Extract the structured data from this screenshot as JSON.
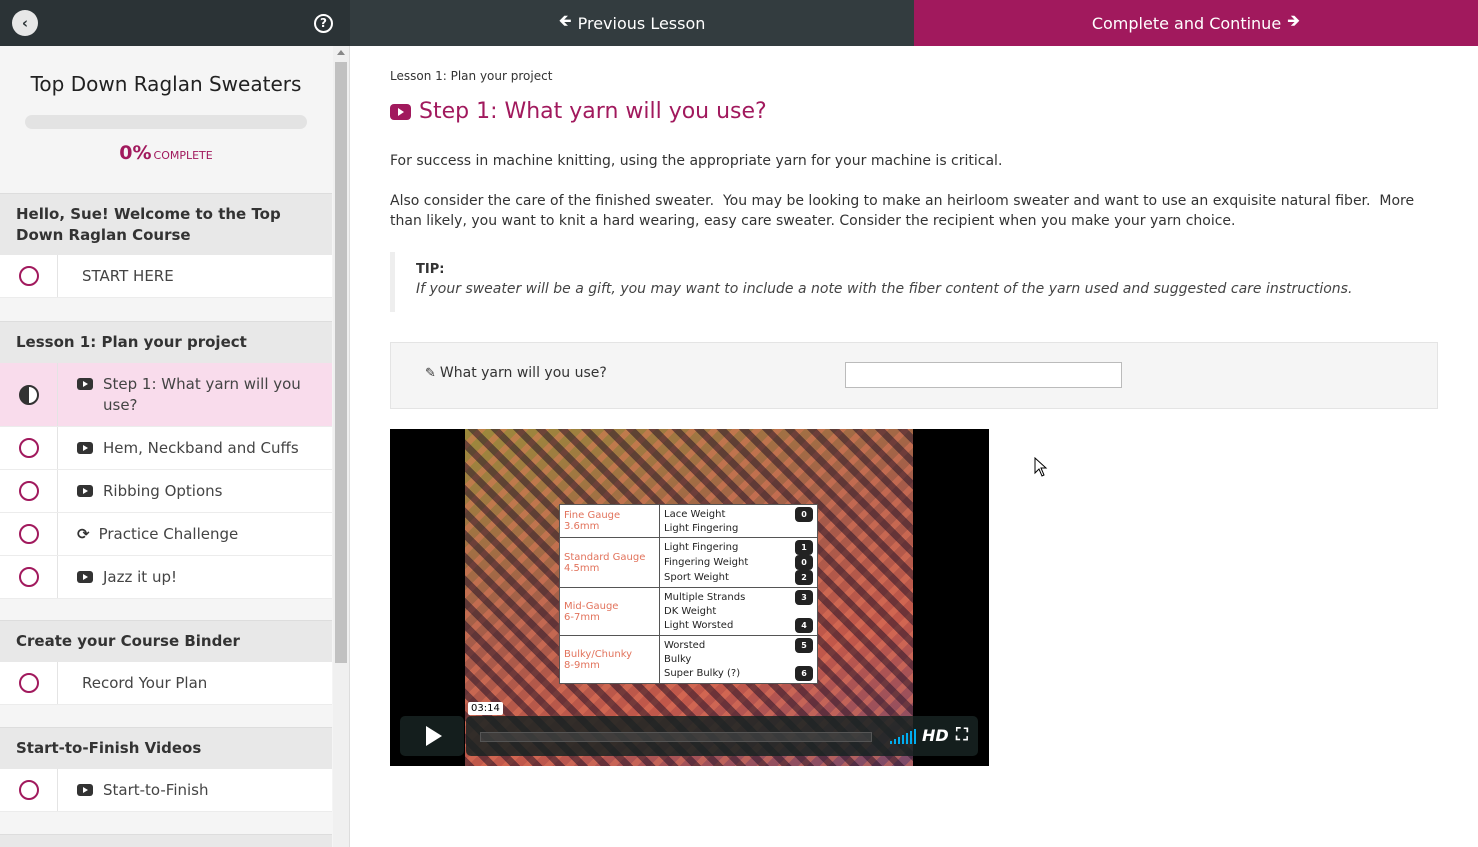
{
  "topbar": {
    "back_icon": "‹",
    "help_icon": "?",
    "previous_label": "Previous Lesson",
    "complete_label": "Complete and Continue",
    "accent": "#a1195d"
  },
  "sidebar": {
    "course_title": "Top Down Raglan Sweaters",
    "progress_percent": 0,
    "progress_value": "0%",
    "progress_label": "COMPLETE",
    "sections": [
      {
        "title": "Hello, Sue! Welcome to the Top Down Raglan Course",
        "lessons": [
          {
            "label": "START HERE",
            "icon": "none",
            "status": "incomplete"
          }
        ]
      },
      {
        "title": "Lesson 1: Plan your project",
        "lessons": [
          {
            "label": "Step 1: What yarn will you use?",
            "icon": "youtube-icon",
            "status": "current"
          },
          {
            "label": "Hem, Neckband and Cuffs",
            "icon": "youtube-icon",
            "status": "incomplete"
          },
          {
            "label": "Ribbing Options",
            "icon": "youtube-icon",
            "status": "incomplete"
          },
          {
            "label": "Practice Challenge",
            "icon": "refresh-icon",
            "status": "incomplete"
          },
          {
            "label": "Jazz it up!",
            "icon": "youtube-icon",
            "status": "incomplete"
          }
        ]
      },
      {
        "title": "Create your Course Binder",
        "lessons": [
          {
            "label": "Record Your Plan",
            "icon": "none",
            "status": "incomplete"
          }
        ]
      },
      {
        "title": "Start-to-Finish Videos",
        "lessons": [
          {
            "label": "Start-to-Finish",
            "icon": "youtube-icon",
            "status": "incomplete"
          }
        ]
      }
    ]
  },
  "main": {
    "breadcrumb": "Lesson 1: Plan your project",
    "title": "Step 1: What yarn will you use?",
    "paragraph1": "For success in machine knitting, using the appropriate yarn for your machine is critical.",
    "paragraph2": "Also consider the care of the finished sweater.  You may be looking to make an heirloom sweater and want to use an exquisite natural fiber.  More than likely, you want to knit a hard wearing, easy care sweater. Consider the recipient when you make your yarn choice.",
    "tip_label": "TIP:",
    "tip_text": "If your sweater will be a gift, you may want to include a note with the fiber content of the yarn used and suggested care instructions.",
    "question_label": "What yarn will you use?",
    "answer_value": "",
    "video": {
      "time": "03:14",
      "hd_label": "HD",
      "table": [
        {
          "gauge": [
            "Fine Gauge",
            "3.6mm"
          ],
          "weights": [
            [
              "Lace Weight",
              "0"
            ],
            [
              "Light Fingering",
              ""
            ]
          ]
        },
        {
          "gauge": [
            "Standard Gauge",
            "4.5mm"
          ],
          "weights": [
            [
              "Light Fingering",
              "1"
            ],
            [
              "Fingering Weight",
              "0"
            ],
            [
              "Sport Weight",
              "2"
            ]
          ]
        },
        {
          "gauge": [
            "Mid-Gauge",
            "6-7mm"
          ],
          "weights": [
            [
              "Multiple Strands",
              "3"
            ],
            [
              "DK Weight",
              ""
            ],
            [
              "Light Worsted",
              "4"
            ]
          ]
        },
        {
          "gauge": [
            "Bulky/Chunky",
            "8-9mm"
          ],
          "weights": [
            [
              "Worsted",
              "5"
            ],
            [
              "Bulky",
              ""
            ],
            [
              "Super Bulky (?)",
              "6"
            ]
          ]
        }
      ]
    }
  }
}
